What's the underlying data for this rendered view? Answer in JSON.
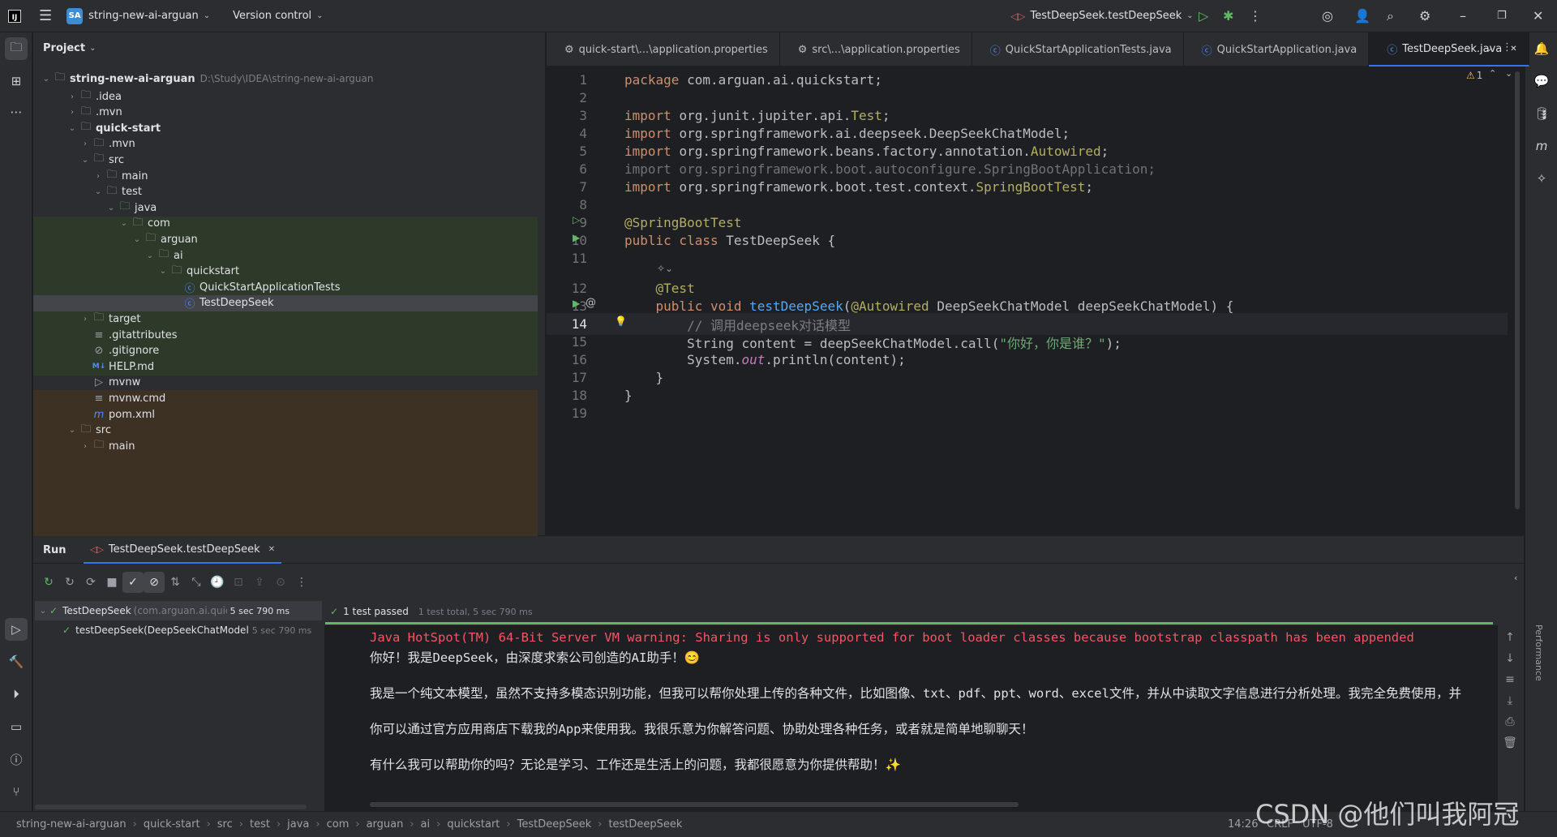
{
  "titlebar": {
    "project_badge": "SA",
    "project_name": "string-new-ai-arguan",
    "vcs": "Version control",
    "run_config": "TestDeepSeek.testDeepSeek"
  },
  "project_panel": {
    "title": "Project",
    "root_name": "string-new-ai-arguan",
    "root_path": "D:\\Study\\IDEA\\string-new-ai-arguan",
    "items": [
      {
        "label": ".idea",
        "icon": "folder-icon"
      },
      {
        "label": ".mvn",
        "icon": "folder-icon"
      },
      {
        "label": "quick-start",
        "icon": "module-icon"
      },
      {
        "label": ".mvn",
        "icon": "folder-icon"
      },
      {
        "label": "src",
        "icon": "folder-icon"
      },
      {
        "label": "main",
        "icon": "folder-icon"
      },
      {
        "label": "test",
        "icon": "folder-icon"
      },
      {
        "label": "java",
        "icon": "test-folder-icon"
      },
      {
        "label": "com",
        "icon": "package-icon"
      },
      {
        "label": "arguan",
        "icon": "package-icon"
      },
      {
        "label": "ai",
        "icon": "package-icon"
      },
      {
        "label": "quickstart",
        "icon": "package-icon"
      },
      {
        "label": "QuickStartApplicationTests",
        "icon": "class-icon"
      },
      {
        "label": "TestDeepSeek",
        "icon": "class-icon"
      },
      {
        "label": "target",
        "icon": "folder-icon"
      },
      {
        "label": ".gitattributes",
        "icon": "text-file-icon"
      },
      {
        "label": ".gitignore",
        "icon": "ignore-file-icon"
      },
      {
        "label": "HELP.md",
        "icon": "markdown-icon"
      },
      {
        "label": "mvnw",
        "icon": "shell-icon"
      },
      {
        "label": "mvnw.cmd",
        "icon": "text-file-icon"
      },
      {
        "label": "pom.xml",
        "icon": "maven-icon"
      },
      {
        "label": "src",
        "icon": "folder-icon"
      },
      {
        "label": "main",
        "icon": "folder-icon"
      }
    ]
  },
  "editor": {
    "tabs": [
      {
        "label": "quick-start\\...\\application.properties"
      },
      {
        "label": "src\\...\\application.properties"
      },
      {
        "label": "QuickStartApplicationTests.java"
      },
      {
        "label": "QuickStartApplication.java"
      },
      {
        "label": "TestDeepSeek.java"
      }
    ],
    "warning_count": "1",
    "line_numbers": [
      "1",
      "2",
      "3",
      "4",
      "5",
      "6",
      "7",
      "8",
      "9",
      "10",
      "11",
      "12",
      "13",
      "14",
      "15",
      "16",
      "17",
      "18",
      "19"
    ],
    "code": {
      "l1a": "package ",
      "l1b": "com.arguan.ai.quickstart;",
      "l3a": "import ",
      "l3b": "org.junit.jupiter.api.",
      "l3c": "Test",
      ";": ";",
      "l4a": "import ",
      "l4b": "org.springframework.ai.deepseek.DeepSeekChatModel;",
      "l5a": "import ",
      "l5b": "org.springframework.beans.factory.annotation.",
      "l5c": "Autowired",
      "l6": "import org.springframework.boot.autoconfigure.SpringBootApplication;",
      "l7a": "import ",
      "l7b": "org.springframework.boot.test.context.",
      "l7c": "SpringBootTest",
      "l9": "@SpringBootTest",
      "l10a": "public class ",
      "l10b": "TestDeepSeek {",
      "l12": "@Test",
      "l13a": "public void ",
      "l13b": "testDeepSeek",
      "l13c": "(",
      "l13d": "@Autowired",
      " l13e": " DeepSeekChatModel deepSeekChatModel) {",
      "l14": "// 调用deepseek对话模型",
      "l15a": "String content = deepSeekChatModel.call(",
      "l15b": "\"你好，你是谁？\"",
      "l15c": ");",
      "l16a": "System.",
      "l16b": "out",
      "l16c": ".println(content);",
      "l17": "}",
      "l18": "}"
    }
  },
  "run_panel": {
    "title": "Run",
    "tab_label": "TestDeepSeek.testDeepSeek",
    "tests": [
      {
        "name": "TestDeepSeek",
        "detail": "(com.arguan.ai.quicksta",
        "time": "5 sec 790 ms"
      },
      {
        "name": "testDeepSeek(DeepSeekChatModel",
        "time": "5 sec 790 ms"
      }
    ],
    "summary_passed": "1 test passed",
    "summary_detail": "1 test total, 5 sec 790 ms",
    "performance_label": "Performance",
    "console": [
      "Java HotSpot(TM) 64-Bit Server VM warning: Sharing is only supported for boot loader classes because bootstrap classpath has been appended",
      "你好！我是DeepSeek，由深度求索公司创造的AI助手！😊",
      "我是一个纯文本模型，虽然不支持多模态识别功能，但我可以帮你处理上传的各种文件，比如图像、txt、pdf、ppt、word、excel文件，并从中读取文字信息进行分析处理。我完全免费使用，并",
      "你可以通过官方应用商店下载我的App来使用我。我很乐意为你解答问题、协助处理各种任务，或者就是简单地聊聊天！",
      "有什么我可以帮助你的吗？无论是学习、工作还是生活上的问题，我都很愿意为你提供帮助！✨"
    ]
  },
  "statusbar": {
    "crumbs": [
      "string-new-ai-arguan",
      "quick-start",
      "src",
      "test",
      "java",
      "com",
      "arguan",
      "ai",
      "quickstart",
      "TestDeepSeek",
      "testDeepSeek"
    ],
    "position": "14:26",
    "line_sep": "CRLF",
    "encoding": "UTF-8",
    "watermark": "CSDN @他们叫我阿冠"
  }
}
